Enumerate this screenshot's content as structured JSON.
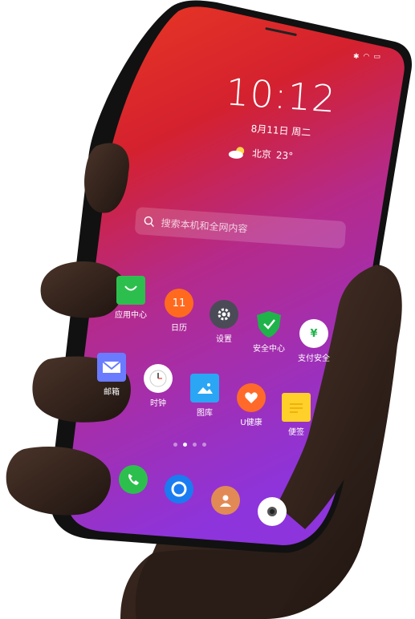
{
  "lockscreen": {
    "time": "10:12",
    "date": "8月11日  周二",
    "weather": {
      "city": "北京",
      "temp": "23°",
      "icon": "partly-cloudy-icon"
    }
  },
  "search": {
    "placeholder": "搜索本机和全网内容",
    "icon": "search-icon"
  },
  "apps_row1": [
    {
      "label": "应用中心",
      "icon": "shopping-bag-icon",
      "color": "#2dbf4e"
    },
    {
      "label": "日历",
      "icon": "calendar-icon",
      "color": "#ff6a1f",
      "text": "11"
    },
    {
      "label": "设置",
      "icon": "gear-icon",
      "color": "#4b4b57"
    },
    {
      "label": "安全中心",
      "icon": "shield-icon",
      "color": "#1fb34a"
    },
    {
      "label": "支付安全",
      "icon": "payment-shield-icon",
      "color": "#ffffff",
      "text": "¥"
    }
  ],
  "apps_row2": [
    {
      "label": "邮箱",
      "icon": "mail-icon",
      "color": "#6a7bff"
    },
    {
      "label": "时钟",
      "icon": "clock-icon",
      "color": "#ffffff"
    },
    {
      "label": "图库",
      "icon": "gallery-icon",
      "color": "#2aa6f5"
    },
    {
      "label": "U健康",
      "icon": "health-heart-icon",
      "color": "#ff6a2a"
    },
    {
      "label": "便签",
      "icon": "notes-icon",
      "color": "#ffcf2a"
    }
  ],
  "dock": [
    {
      "icon": "phone-icon",
      "color": "#2dbf4e"
    },
    {
      "icon": "browser-icon",
      "color": "#1a7cf0"
    },
    {
      "icon": "contacts-icon",
      "color": "#e28a55"
    },
    {
      "icon": "camera-icon",
      "color": "#ffffff"
    }
  ],
  "page_indicator": {
    "pages": 4,
    "current": 2
  },
  "colors": {
    "screen_top": "#e8342a",
    "screen_mid": "#c7206b",
    "screen_bottom": "#8a2fd6",
    "skin": "#3a2a22"
  }
}
